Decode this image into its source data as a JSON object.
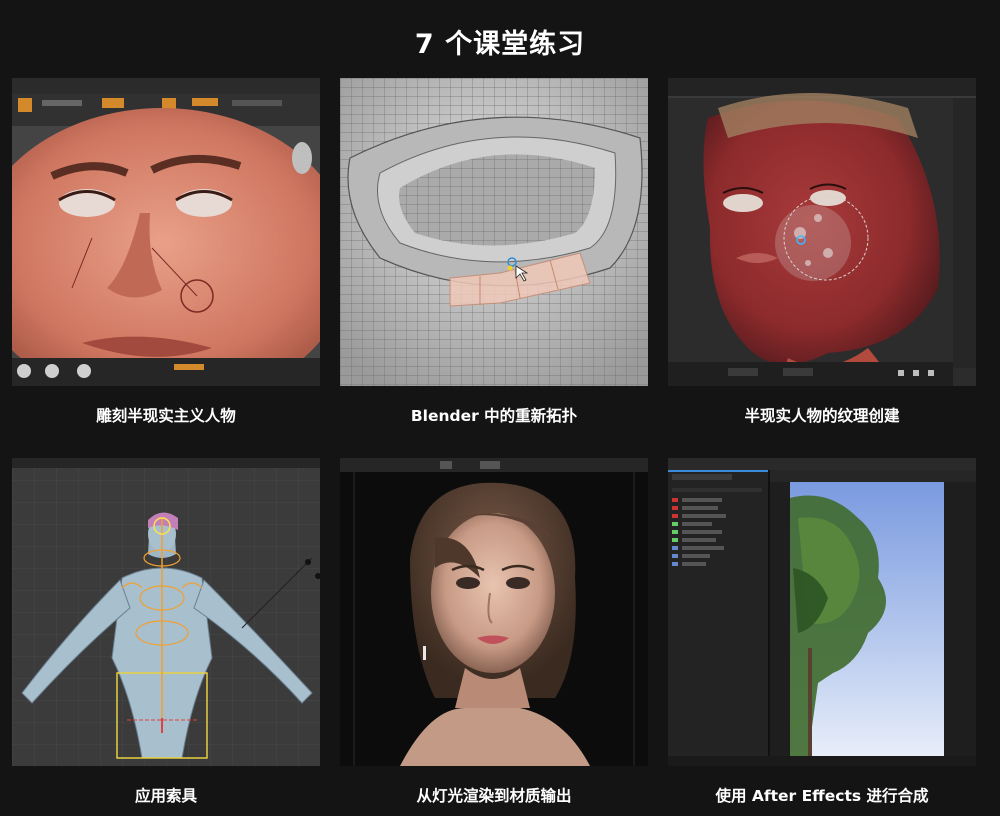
{
  "header": {
    "title": "7 个课堂练习"
  },
  "exercises": [
    {
      "caption": "雕刻半现实主义人物",
      "thumbnail": "zbrush-face-sculpt"
    },
    {
      "caption": "Blender 中的重新拓扑",
      "thumbnail": "blender-retopology-mesh"
    },
    {
      "caption": "半现实人物的纹理创建",
      "thumbnail": "substance-texture-painting"
    },
    {
      "caption": "应用索具",
      "thumbnail": "blender-rigging"
    },
    {
      "caption": "从灯光渲染到材质输出",
      "thumbnail": "final-render-portrait"
    },
    {
      "caption": "使用 After Effects 进行合成",
      "thumbnail": "after-effects-compositing"
    }
  ],
  "colors": {
    "background": "#141414",
    "text": "#ffffff"
  }
}
